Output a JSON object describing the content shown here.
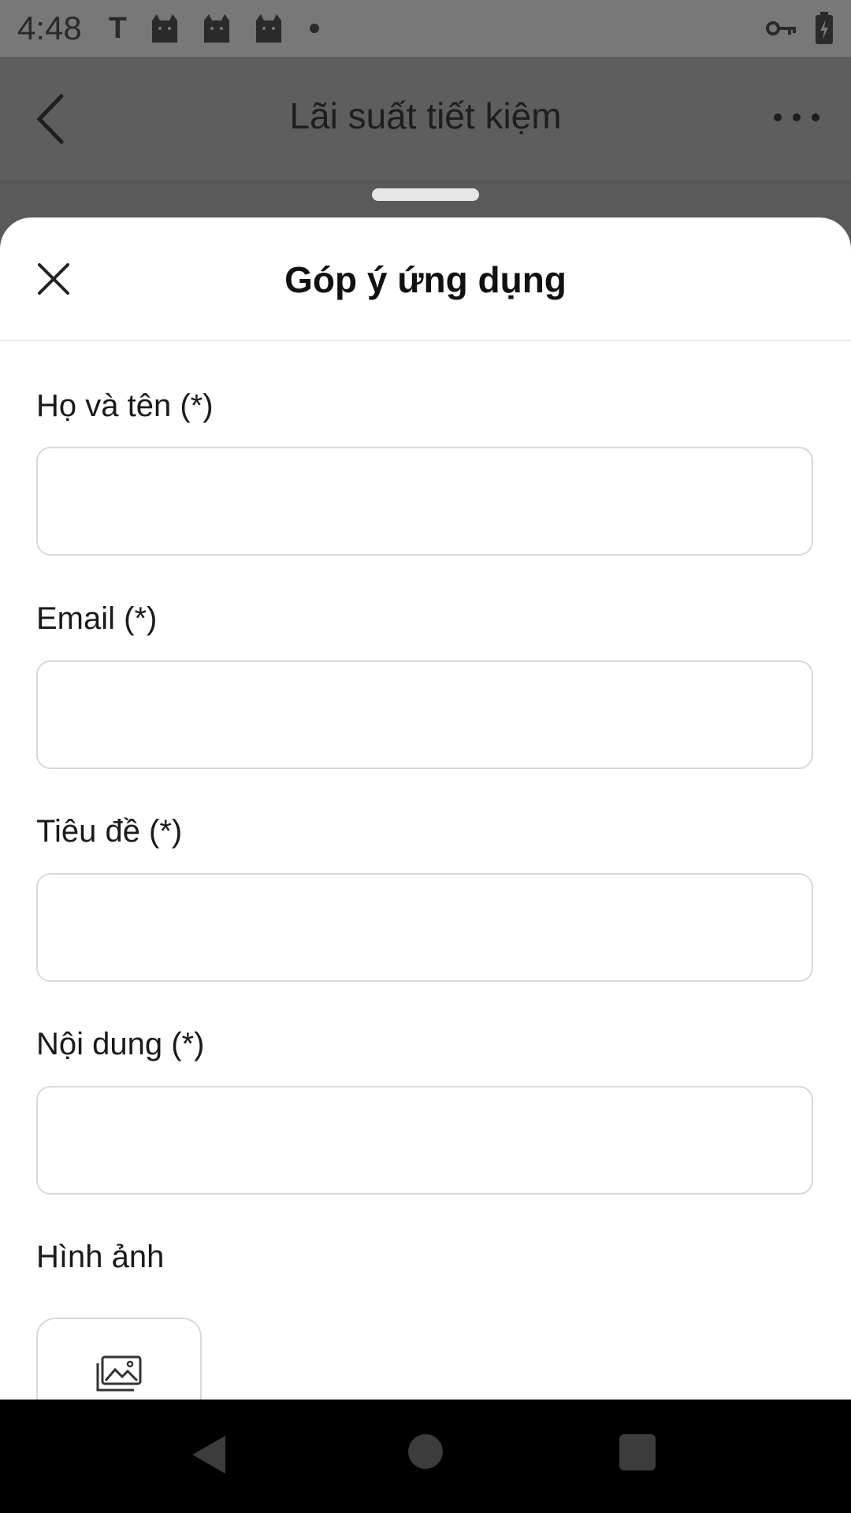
{
  "status_bar": {
    "time": "4:48",
    "notification_letter": "T",
    "icons": [
      "cat-icon",
      "cat-icon",
      "cat-icon",
      "dot-icon",
      "key-icon",
      "battery-charging-icon"
    ]
  },
  "app_bar": {
    "title": "Lãi suất tiết kiệm",
    "back_icon": "chevron-left-icon",
    "more_icon": "more-horizontal-icon"
  },
  "sheet": {
    "title": "Góp ý ứng dụng",
    "close_icon": "close-icon"
  },
  "form": {
    "full_name": {
      "label": "Họ và tên (*)",
      "value": "",
      "placeholder": ""
    },
    "email": {
      "label": "Email (*)",
      "value": "",
      "placeholder": ""
    },
    "subject": {
      "label": "Tiêu đề (*)",
      "value": "",
      "placeholder": ""
    },
    "content": {
      "label": "Nội dung (*)",
      "value": "",
      "placeholder": ""
    },
    "images": {
      "label": "Hình ảnh",
      "icon": "image-gallery-icon"
    }
  },
  "nav_bar": {
    "icons": [
      "nav-back-icon",
      "nav-home-icon",
      "nav-recent-icon"
    ]
  },
  "colors": {
    "sheet_background": "#ffffff",
    "overlay": "#5a5a5a",
    "input_border": "#d9d9d9",
    "nav_bar": "#000000"
  }
}
